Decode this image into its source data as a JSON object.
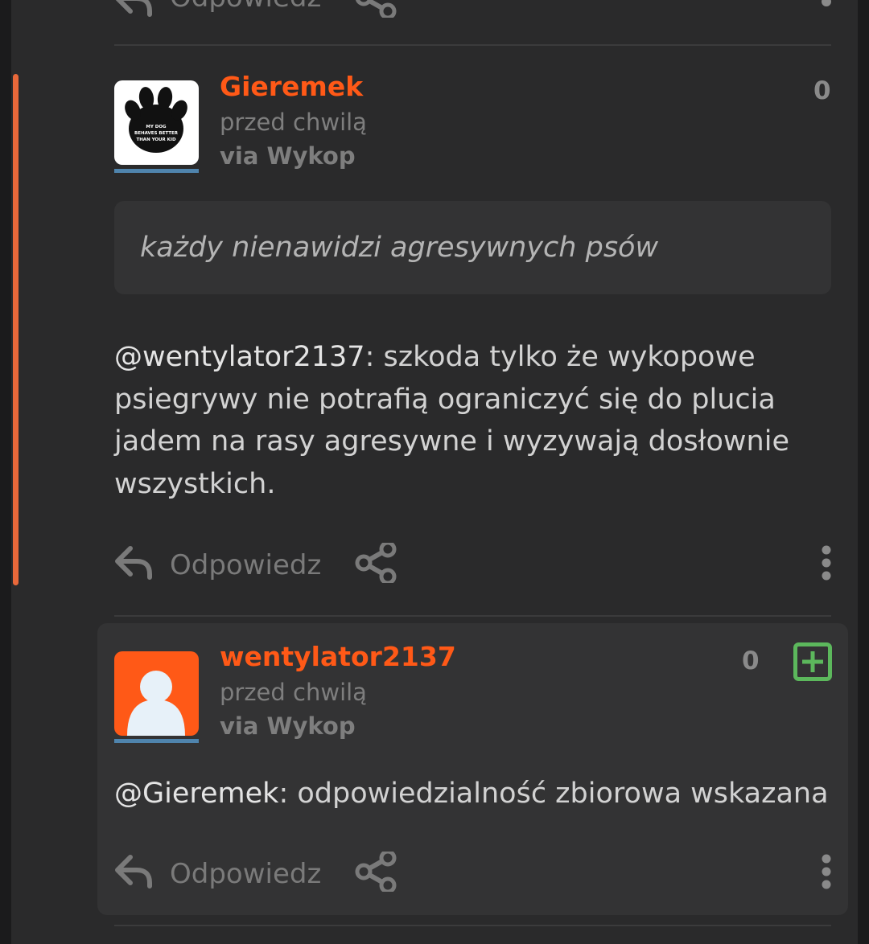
{
  "top_partial": {
    "reply_label": "Odpowiedz"
  },
  "comment": {
    "author": "Gieremek",
    "time": "przed chwilą",
    "via": "via Wykop",
    "score": "0",
    "avatar_text": "MY DOG BEHAVES BETTER THAN YOUR KID",
    "quote": "każdy nienawidzi agresywnych psów",
    "mention": "@wentylator2137",
    "text": ": szkoda tylko że wykopowe psiegrywy nie potrafią ograniczyć się do plucia jadem na rasy agresywne i wyzywają dosłownie wszystkich.",
    "reply_label": "Odpowiedz"
  },
  "reply": {
    "author": "wentylator2137",
    "time": "przed chwilą",
    "via": "via Wykop",
    "score": "0",
    "mention": "@Gieremek",
    "text": ": odpowiedzialność zbiorowa wskazana",
    "reply_label": "Odpowiedz"
  },
  "colors": {
    "author": "#ff5917",
    "accent_bar": "#e8683a",
    "plus_button": "#5cb85c",
    "avatar_underline": "#4f84ad"
  },
  "icons": {
    "reply": "reply-arrow-icon",
    "share": "share-icon",
    "more": "vertical-dots-icon",
    "plus": "plus-square-icon",
    "default_avatar": "user-silhouette-icon"
  }
}
